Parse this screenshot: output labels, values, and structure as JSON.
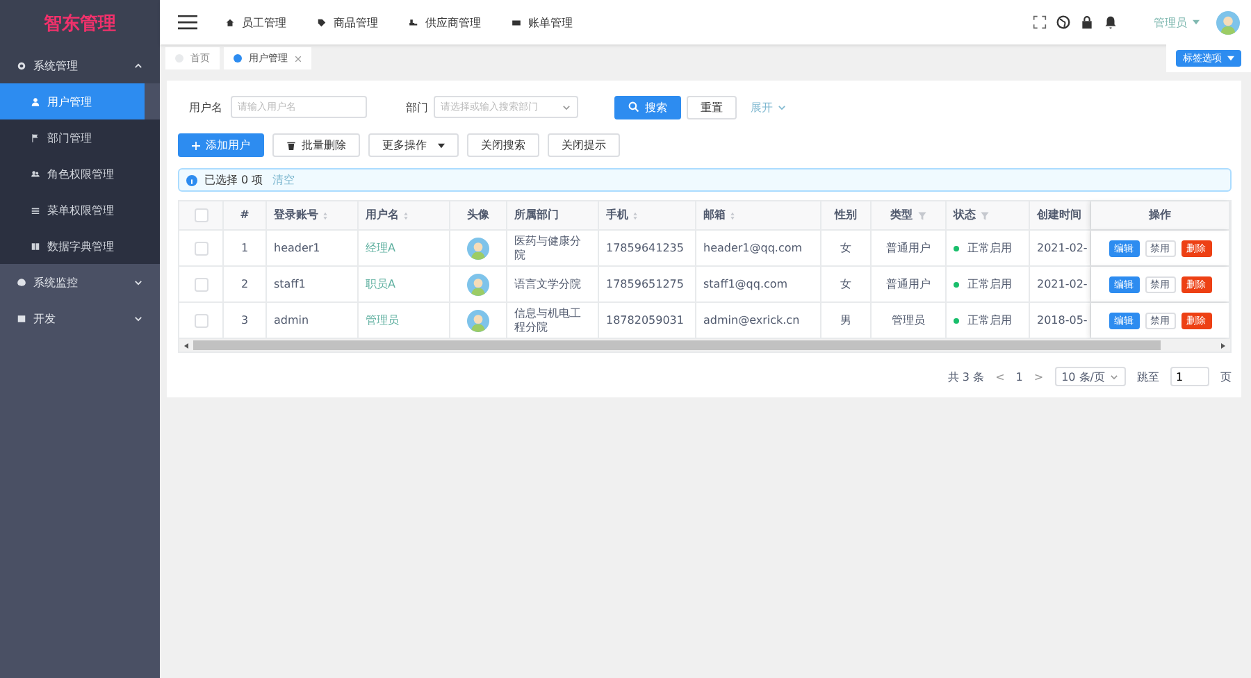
{
  "logo": "智东管理",
  "sidebar": {
    "items": [
      {
        "label": "系统管理",
        "expanded": true,
        "children": [
          {
            "label": "用户管理",
            "selected": true
          },
          {
            "label": "部门管理",
            "selected": false
          },
          {
            "label": "角色权限管理",
            "selected": false
          },
          {
            "label": "菜单权限管理",
            "selected": false
          },
          {
            "label": "数据字典管理",
            "selected": false
          }
        ]
      },
      {
        "label": "系统监控",
        "expanded": false
      },
      {
        "label": "开发",
        "expanded": false
      }
    ]
  },
  "top_nav": [
    {
      "label": "员工管理"
    },
    {
      "label": "商品管理"
    },
    {
      "label": "供应商管理"
    },
    {
      "label": "账单管理"
    }
  ],
  "user": {
    "name": "管理员"
  },
  "tabs": [
    {
      "label": "首页",
      "selected": false,
      "closable": false
    },
    {
      "label": "用户管理",
      "selected": true,
      "closable": true
    }
  ],
  "tab_options": "标签选项",
  "search": {
    "username_label": "用户名",
    "username_placeholder": "请输入用户名",
    "dept_label": "部门",
    "dept_placeholder": "请选择或输入搜索部门",
    "search_button": "搜索",
    "reset_button": "重置",
    "expand_link": "展开"
  },
  "toolbar": [
    {
      "label": "添加用户",
      "kind": "primary"
    },
    {
      "label": "批量删除",
      "kind": "trash"
    },
    {
      "label": "更多操作",
      "kind": "dropdown"
    },
    {
      "label": "关闭搜索",
      "kind": "plain"
    },
    {
      "label": "关闭提示",
      "kind": "plain"
    }
  ],
  "alert": {
    "text": "已选择 0 项",
    "link": "清空"
  },
  "table": {
    "select_all_checked": false,
    "columns": [
      "#",
      "登录账号",
      "用户名",
      "头像",
      "所属部门",
      "手机",
      "邮箱",
      "性别",
      "类型",
      "状态",
      "创建时间",
      "操作"
    ],
    "rows": [
      {
        "index": "1",
        "account": "header1",
        "name": "经理A",
        "dept": "医药与健康分院",
        "phone": "17859641235",
        "email": "header1@qq.com",
        "gender": "女",
        "type": "普通用户",
        "status": "正常启用",
        "created": "2021-02-",
        "checked": false,
        "actions": [
          "编辑",
          "禁用",
          "删除"
        ]
      },
      {
        "index": "2",
        "account": "staff1",
        "name": "职员A",
        "dept": "语言文学分院",
        "phone": "17859651275",
        "email": "staff1@qq.com",
        "gender": "女",
        "type": "普通用户",
        "status": "正常启用",
        "created": "2021-02-",
        "checked": false,
        "actions": [
          "编辑",
          "禁用",
          "删除"
        ]
      },
      {
        "index": "3",
        "account": "admin",
        "name": "管理员",
        "dept": "信息与机电工程分院",
        "phone": "18782059031",
        "email": "admin@exrick.cn",
        "gender": "男",
        "type": "管理员",
        "status": "正常启用",
        "created": "2018-05-",
        "checked": false,
        "actions": [
          "编辑",
          "禁用",
          "删除"
        ]
      }
    ]
  },
  "pagination": {
    "total": "共 3 条",
    "prev": "<",
    "page": "1",
    "next": ">",
    "page_size": "10 条/页",
    "jump_label": "跳至",
    "jump_value": "1",
    "jump_suffix": "页"
  }
}
